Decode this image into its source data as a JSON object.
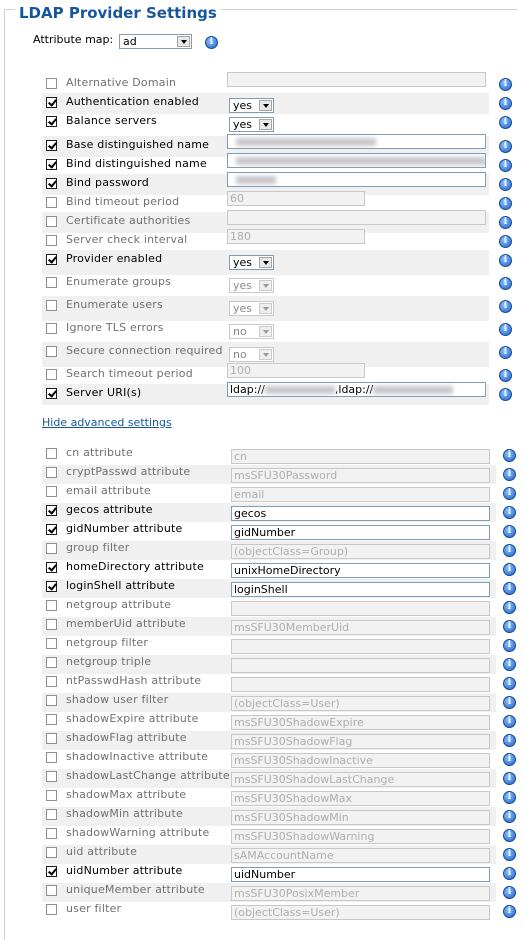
{
  "title": "LDAP Provider Settings",
  "attribute_map": {
    "label": "Attribute map:",
    "value": "ad"
  },
  "info_glyph": "i",
  "provider_rows": [
    {
      "label": "Alternative Domain",
      "checked": false,
      "type": "text",
      "enabled": false,
      "value": ""
    },
    {
      "label": "Authentication enabled",
      "checked": true,
      "type": "select",
      "enabled": true,
      "value": "yes"
    },
    {
      "label": "Balance servers",
      "checked": true,
      "type": "select",
      "enabled": true,
      "value": "yes"
    },
    {
      "label": "Base distinguished name",
      "checked": true,
      "type": "text",
      "enabled": true,
      "value": "",
      "redacted": true
    },
    {
      "label": "Bind distinguished name",
      "checked": true,
      "type": "text",
      "enabled": true,
      "value": "",
      "redacted": true
    },
    {
      "label": "Bind password",
      "checked": true,
      "type": "text",
      "enabled": true,
      "value": "",
      "redacted": true
    },
    {
      "label": "Bind timeout period",
      "checked": false,
      "type": "text",
      "enabled": false,
      "value": "60"
    },
    {
      "label": "Certificate authorities",
      "checked": false,
      "type": "text",
      "enabled": false,
      "value": ""
    },
    {
      "label": "Server check interval",
      "checked": false,
      "type": "text",
      "enabled": false,
      "value": "180"
    },
    {
      "label": "Provider enabled",
      "checked": true,
      "type": "select",
      "enabled": true,
      "value": "yes"
    },
    {
      "label": "Enumerate groups",
      "checked": false,
      "type": "select",
      "enabled": false,
      "value": "yes"
    },
    {
      "label": "Enumerate users",
      "checked": false,
      "type": "select",
      "enabled": false,
      "value": "yes"
    },
    {
      "label": "Ignore TLS errors",
      "checked": false,
      "type": "select",
      "enabled": false,
      "value": "no"
    },
    {
      "label": "Secure connection required",
      "checked": false,
      "type": "select",
      "enabled": false,
      "value": "no"
    },
    {
      "label": "Search timeout period",
      "checked": false,
      "type": "text",
      "enabled": false,
      "value": "100"
    },
    {
      "label": "Server URI(s)",
      "checked": true,
      "type": "text",
      "enabled": true,
      "value": "ldap://",
      "value2": ",ldap://",
      "redacted": true
    }
  ],
  "advanced_link": "Hide advanced settings",
  "advanced_rows": [
    {
      "label": "cn attribute",
      "checked": false,
      "enabled": false,
      "value": "cn"
    },
    {
      "label": "cryptPasswd attribute",
      "checked": false,
      "enabled": false,
      "value": "msSFU30Password"
    },
    {
      "label": "email attribute",
      "checked": false,
      "enabled": false,
      "value": "email"
    },
    {
      "label": "gecos attribute",
      "checked": true,
      "enabled": true,
      "value": "gecos"
    },
    {
      "label": "gidNumber attribute",
      "checked": true,
      "enabled": true,
      "value": "gidNumber"
    },
    {
      "label": "group filter",
      "checked": false,
      "enabled": false,
      "value": "(objectClass=Group)"
    },
    {
      "label": "homeDirectory attribute",
      "checked": true,
      "enabled": true,
      "value": "unixHomeDirectory"
    },
    {
      "label": "loginShell attribute",
      "checked": true,
      "enabled": true,
      "value": "loginShell"
    },
    {
      "label": "netgroup attribute",
      "checked": false,
      "enabled": false,
      "value": ""
    },
    {
      "label": "memberUid attribute",
      "checked": false,
      "enabled": false,
      "value": "msSFU30MemberUid"
    },
    {
      "label": "netgroup filter",
      "checked": false,
      "enabled": false,
      "value": ""
    },
    {
      "label": "netgroup triple",
      "checked": false,
      "enabled": false,
      "value": ""
    },
    {
      "label": "ntPasswdHash attribute",
      "checked": false,
      "enabled": false,
      "value": ""
    },
    {
      "label": "shadow user filter",
      "checked": false,
      "enabled": false,
      "value": "(objectClass=User)"
    },
    {
      "label": "shadowExpire attribute",
      "checked": false,
      "enabled": false,
      "value": "msSFU30ShadowExpire"
    },
    {
      "label": "shadowFlag attribute",
      "checked": false,
      "enabled": false,
      "value": "msSFU30ShadowFlag"
    },
    {
      "label": "shadowInactive attribute",
      "checked": false,
      "enabled": false,
      "value": "msSFU30ShadowInactive"
    },
    {
      "label": "shadowLastChange attribute",
      "checked": false,
      "enabled": false,
      "value": "msSFU30ShadowLastChange"
    },
    {
      "label": "shadowMax attribute",
      "checked": false,
      "enabled": false,
      "value": "msSFU30ShadowMax"
    },
    {
      "label": "shadowMin attribute",
      "checked": false,
      "enabled": false,
      "value": "msSFU30ShadowMin"
    },
    {
      "label": "shadowWarning attribute",
      "checked": false,
      "enabled": false,
      "value": "msSFU30ShadowWarning"
    },
    {
      "label": "uid attribute",
      "checked": false,
      "enabled": false,
      "value": "sAMAccountName"
    },
    {
      "label": "uidNumber attribute",
      "checked": true,
      "enabled": true,
      "value": "uidNumber"
    },
    {
      "label": "uniqueMember attribute",
      "checked": false,
      "enabled": false,
      "value": "msSFU30PosixMember"
    },
    {
      "label": "user filter",
      "checked": false,
      "enabled": false,
      "value": "(objectClass=User)"
    }
  ]
}
